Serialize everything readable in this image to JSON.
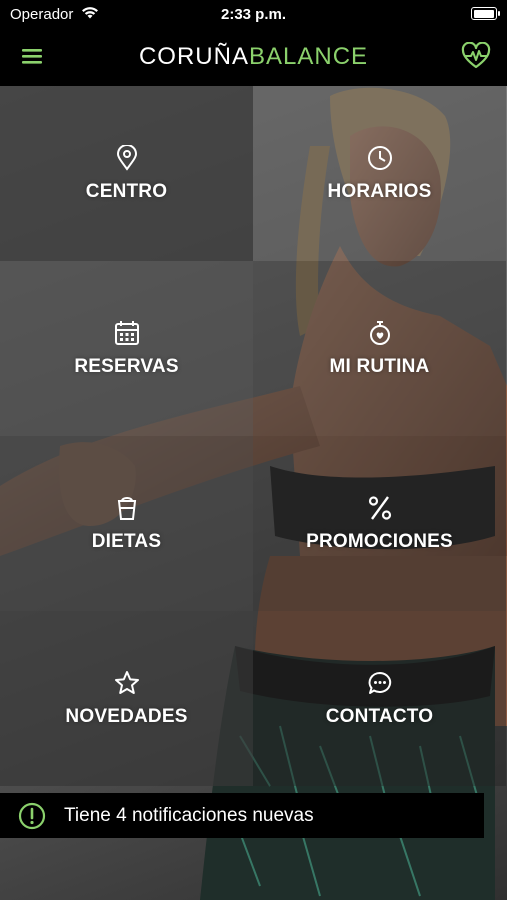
{
  "status_bar": {
    "carrier": "Operador",
    "time": "2:33 p.m."
  },
  "header": {
    "logo_part1": "CORUÑA",
    "logo_part2": "BALANCE",
    "accent_color": "#8bd16c"
  },
  "menu": {
    "items": [
      {
        "label": "CENTRO",
        "icon": "location-pin-icon"
      },
      {
        "label": "HORARIOS",
        "icon": "clock-icon"
      },
      {
        "label": "RESERVAS",
        "icon": "calendar-icon"
      },
      {
        "label": "MI RUTINA",
        "icon": "stopwatch-icon"
      },
      {
        "label": "DIETAS",
        "icon": "drink-cup-icon"
      },
      {
        "label": "PROMOCIONES",
        "icon": "percent-icon"
      },
      {
        "label": "NOVEDADES",
        "icon": "star-icon"
      },
      {
        "label": "CONTACTO",
        "icon": "chat-bubble-icon"
      }
    ]
  },
  "notification": {
    "text": "Tiene 4 notificaciones nuevas",
    "icon": "alert-circle-icon"
  }
}
